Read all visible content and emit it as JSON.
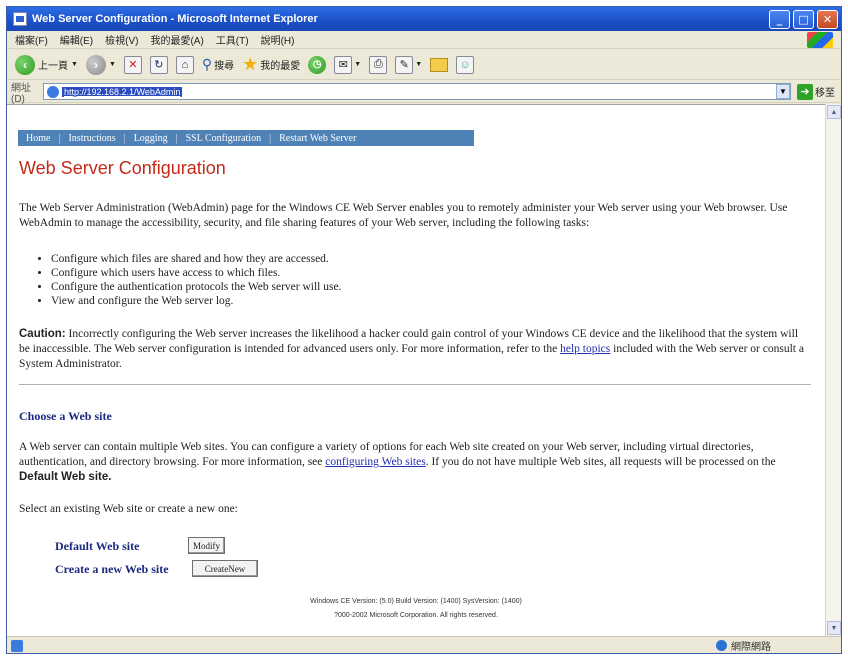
{
  "window": {
    "title": "Web Server Configuration - Microsoft Internet Explorer",
    "buttons": {
      "minimize": "_",
      "maximize": "□",
      "close": "✕"
    }
  },
  "menubar": {
    "items": [
      "檔案(F)",
      "編輯(E)",
      "檢視(V)",
      "我的最愛(A)",
      "工具(T)",
      "說明(H)"
    ]
  },
  "toolbar": {
    "back_label": "上一頁",
    "search_label": "搜尋",
    "favorites_label": "我的最愛"
  },
  "addressbar": {
    "label": "網址(D)",
    "url": "http://192.168.2.1/WebAdmin",
    "go_label": "移至"
  },
  "nav": {
    "items": [
      "Home",
      "Instructions",
      "Logging",
      "SSL Configuration",
      "Restart Web Server"
    ]
  },
  "page": {
    "title": "Web Server Configuration",
    "intro": "The Web Server Administration (WebAdmin) page for the Windows CE Web Server enables you to remotely administer your Web server using your Web browser. Use WebAdmin to manage the accessibility, security, and file sharing features of your Web server, including the following tasks:",
    "tasks": [
      "Configure which files are shared and how they are accessed.",
      "Configure which users have access to which files.",
      "Configure the authentication protocols the Web server will use.",
      "View and configure the Web server log."
    ],
    "caution_label": "Caution:",
    "caution_text": "Incorrectly configuring the Web server increases the likelihood a hacker could gain control of your Windows CE device and the likelihood that the system will be inaccessible. The Web server configuration is intended for advanced users only. For more information, refer to the",
    "caution_link": "help topics",
    "caution_tail": "included with the Web server or consult a System Administrator.",
    "choose_title": "Choose a Web site",
    "choose_text_1": "A Web server can contain multiple Web sites. You can configure a variety of options for each Web site created on your Web server, including virtual directories, authentication, and directory browsing. For more information, see",
    "choose_link": "configuring Web sites",
    "choose_text_2": ". If you do not have multiple Web sites, all requests will be processed on the",
    "default_site_inline": "Default Web site.",
    "select_prompt": "Select an existing Web site or create a new one:",
    "default_site_label": "Default Web site",
    "modify_button": "Modify",
    "new_site_label": "Create a new Web site",
    "create_button": "CreateNew",
    "footer_version": "Windows CE Version: (5.0) Build Version: (1400) SysVersion: (1400)",
    "footer_copyright": "?000-2002 Microsoft Corporation. All rights reserved."
  },
  "statusbar": {
    "zone": "網際網路"
  }
}
